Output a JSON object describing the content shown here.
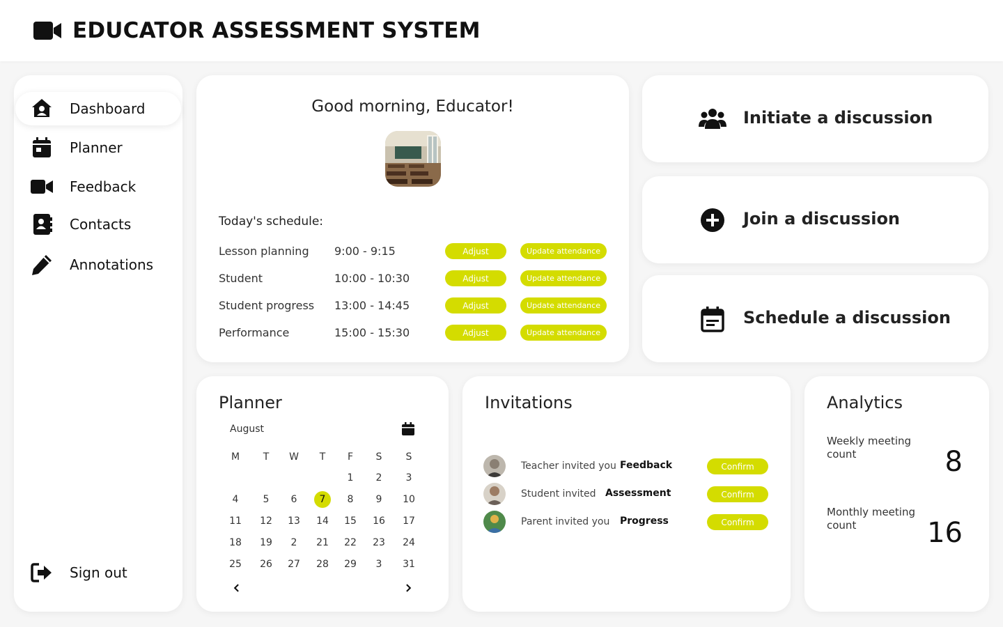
{
  "app": {
    "title": "EDUCATOR ASSESSMENT SYSTEM",
    "logo_icon": "video-camera-icon"
  },
  "sidebar": {
    "items": [
      {
        "label": "Dashboard",
        "icon": "home-icon",
        "active": true
      },
      {
        "label": "Planner",
        "icon": "calendar-icon"
      },
      {
        "label": "Feedback",
        "icon": "video-camera-icon"
      },
      {
        "label": "Contacts",
        "icon": "contact-book-icon"
      },
      {
        "label": "Annotations",
        "icon": "pencil-icon"
      }
    ],
    "signout": {
      "label": "Sign out",
      "icon": "sign-out-icon"
    }
  },
  "greeting": {
    "text": "Good morning, Educator!",
    "image": "classroom-photo",
    "schedule_title": "Today's schedule:",
    "schedule": [
      {
        "name": "Lesson planning",
        "time": "9:00 - 9:15",
        "adjust": "Adjust",
        "update": "Update attendance"
      },
      {
        "name": "Student",
        "time": "10:00 - 10:30",
        "adjust": "Adjust",
        "update": "Update attendance"
      },
      {
        "name": "Student progress",
        "time": "13:00 - 14:45",
        "adjust": "Adjust",
        "update": "Update attendance"
      },
      {
        "name": "Performance",
        "time": "15:00 - 15:30",
        "adjust": "Adjust",
        "update": "Update attendance"
      }
    ]
  },
  "actions": [
    {
      "label": "Initiate a discussion",
      "icon": "users-icon"
    },
    {
      "label": "Join a discussion",
      "icon": "plus-circle-icon"
    },
    {
      "label": "Schedule a discussion",
      "icon": "calendar-schedule-icon"
    }
  ],
  "planner": {
    "title": "Planner",
    "month": "August",
    "weekdays": [
      "M",
      "T",
      "W",
      "T",
      "F",
      "S",
      "S"
    ],
    "weeks": [
      [
        "",
        "",
        "",
        "",
        "1",
        "2",
        "3"
      ],
      [
        "4",
        "5",
        "6",
        "7",
        "8",
        "9",
        "10"
      ],
      [
        "11",
        "12",
        "13",
        "14",
        "15",
        "16",
        "17"
      ],
      [
        "18",
        "19",
        "2",
        "21",
        "22",
        "23",
        "24"
      ],
      [
        "25",
        "26",
        "27",
        "28",
        "29",
        "3",
        "31"
      ]
    ],
    "today": "7",
    "accent": "#d4dc00"
  },
  "invitations": {
    "title": "Invitations",
    "items": [
      {
        "text": "Teacher invited you",
        "topic": "Feedback",
        "button": "Confirm"
      },
      {
        "text": "Student invited",
        "topic": "Assessment",
        "button": "Confirm"
      },
      {
        "text": "Parent invited you",
        "topic": "Progress",
        "button": "Confirm"
      }
    ]
  },
  "analytics": {
    "title": "Analytics",
    "metrics": [
      {
        "label": "Weekly meeting count",
        "value": "8"
      },
      {
        "label": "Monthly meeting count",
        "value": "16"
      }
    ]
  }
}
